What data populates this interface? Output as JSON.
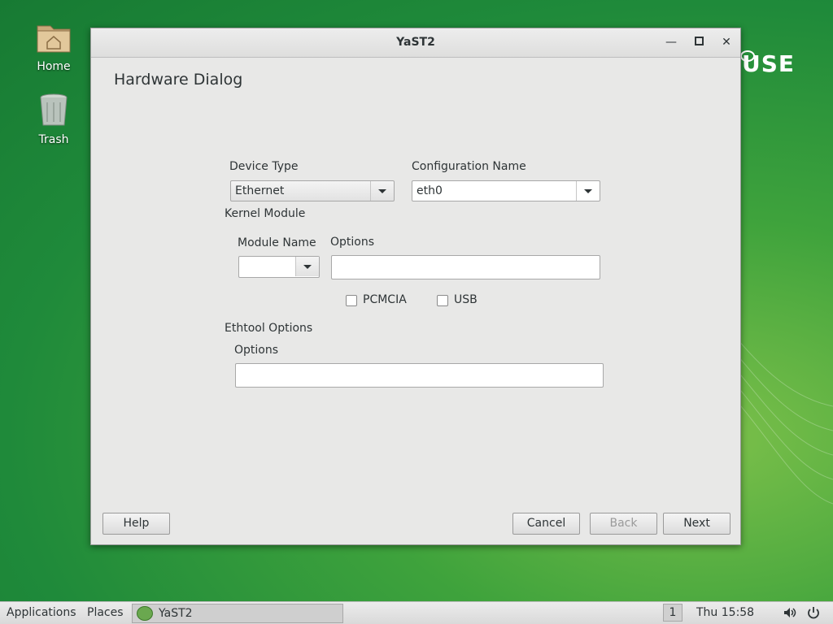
{
  "desktop": {
    "icons": [
      {
        "label": "Home"
      },
      {
        "label": "Trash"
      }
    ],
    "brand_text": "USE"
  },
  "window": {
    "title": "YaST2",
    "dialog_title": "Hardware Dialog",
    "device_type": {
      "label": "Device Type",
      "value": "Ethernet"
    },
    "configuration_name": {
      "label": "Configuration Name",
      "value": "eth0"
    },
    "kernel_module": {
      "heading": "Kernel Module",
      "module_name_label": "Module Name",
      "module_name_value": "",
      "options_label": "Options",
      "options_value": "",
      "pcmcia_label": "PCMCIA",
      "pcmcia_checked": false,
      "usb_label": "USB",
      "usb_checked": false
    },
    "ethtool": {
      "heading": "Ethtool Options",
      "options_label": "Options",
      "options_value": ""
    },
    "buttons": {
      "help": "Help",
      "cancel": "Cancel",
      "back": "Back",
      "next": "Next"
    }
  },
  "taskbar": {
    "applications": "Applications",
    "places": "Places",
    "task_title": "YaST2",
    "workspace": "1",
    "clock": "Thu 15:58"
  }
}
